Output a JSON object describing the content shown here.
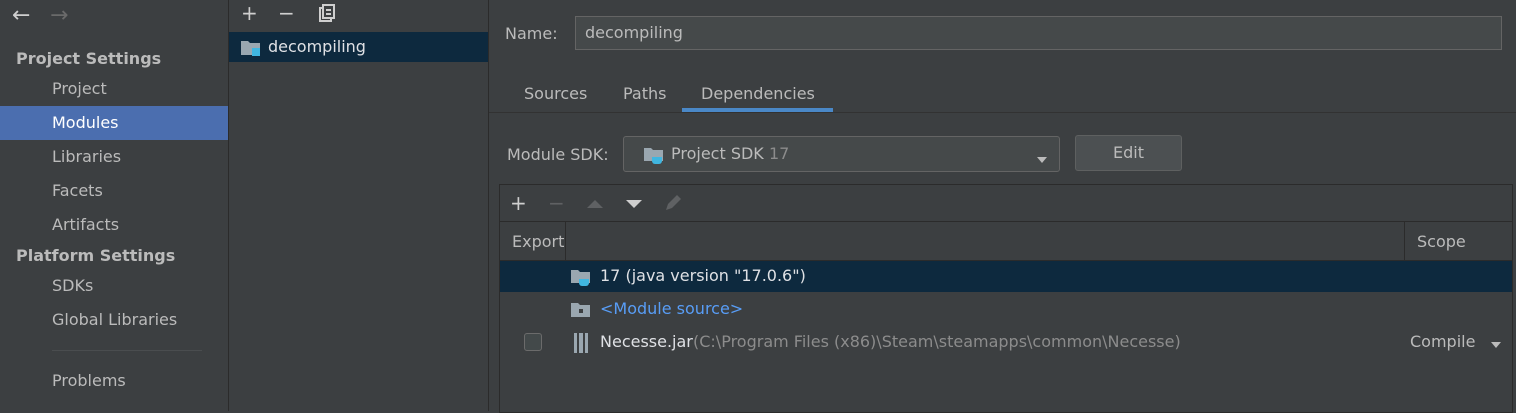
{
  "nav": {
    "back_icon": "arrow-left-icon",
    "forward_icon": "arrow-right-icon"
  },
  "sidebar": {
    "project_settings_title": "Project Settings",
    "project_items": [
      "Project",
      "Modules",
      "Libraries",
      "Facets",
      "Artifacts"
    ],
    "platform_settings_title": "Platform Settings",
    "platform_items": [
      "SDKs",
      "Global Libraries"
    ],
    "problems": "Problems",
    "selected": "Modules"
  },
  "modules_panel": {
    "toolbar": [
      "plus-icon",
      "minus-icon",
      "copy-icon"
    ],
    "module_name": "decompiling"
  },
  "details": {
    "name_label": "Name:",
    "name_value": "decompiling",
    "tabs": [
      "Sources",
      "Paths",
      "Dependencies"
    ],
    "active_tab": "Dependencies",
    "module_sdk_label": "Module SDK:",
    "sdk_name": "Project SDK",
    "sdk_version": "17",
    "edit_button": "Edit",
    "dep_toolbar": [
      "plus-icon",
      "minus-icon",
      "move-up-icon",
      "move-down-icon",
      "edit-pencil-icon"
    ],
    "table": {
      "col_export": "Export",
      "col_scope": "Scope",
      "rows": [
        {
          "name": "17 (java version \"17.0.6\")",
          "path": "",
          "scope": ""
        },
        {
          "name": "<Module source>",
          "path": "",
          "scope": ""
        },
        {
          "name": "Necesse.jar",
          "path": "(C:\\Program Files (x86)\\Steam\\steamapps\\common\\Necesse)",
          "scope": "Compile"
        }
      ]
    }
  },
  "colors": {
    "background": "#3c3f41",
    "selection": "#4b6eaf",
    "row_selection": "#0d293e",
    "link": "#589df6",
    "tab_underline": "#4a88c7"
  }
}
